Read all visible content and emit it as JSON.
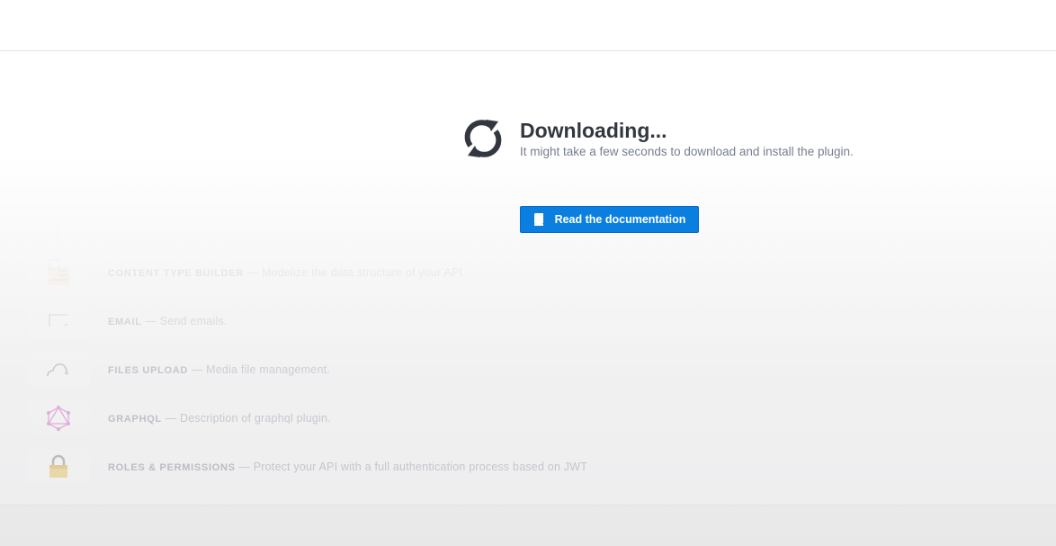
{
  "download": {
    "title": "Downloading...",
    "subtitle": "It might take a few seconds to download and install the plugin.",
    "icon": "sync-icon"
  },
  "doc_button": {
    "label": "Read the documentation",
    "icon": "book-icon",
    "color": "#0a7fe0"
  },
  "plugins": [
    {
      "name": "CONTENT TYPE BUILDER",
      "separator": "—",
      "description": "Modelize the data structure of your API.",
      "icon": "content-type-builder-icon"
    },
    {
      "name": "EMAIL",
      "separator": "—",
      "description": "Send emails.",
      "icon": "email-icon"
    },
    {
      "name": "FILES UPLOAD",
      "separator": "—",
      "description": "Media file management.",
      "icon": "cloud-upload-icon"
    },
    {
      "name": "GRAPHQL",
      "separator": "—",
      "description": "Description of graphql plugin.",
      "icon": "graphql-icon"
    },
    {
      "name": "ROLES & PERMISSIONS",
      "separator": "—",
      "description": "Protect your API with a full authentication process based on JWT",
      "icon": "lock-icon"
    }
  ]
}
